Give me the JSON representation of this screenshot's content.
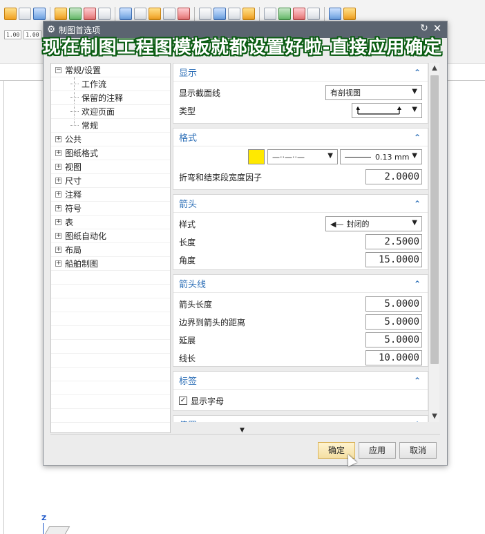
{
  "toolbar": {
    "num_a": "1.00",
    "num_b": "1.00"
  },
  "axis": {
    "z_label": "Z"
  },
  "dialog": {
    "title": "制图首选项",
    "reset_glyph": "↻",
    "close_glyph": "✕"
  },
  "tree": {
    "items": [
      {
        "label": "常规/设置",
        "expander": "−",
        "level": 0
      },
      {
        "label": "工作流",
        "expander": "",
        "level": 1
      },
      {
        "label": "保留的注释",
        "expander": "",
        "level": 1
      },
      {
        "label": "欢迎页面",
        "expander": "",
        "level": 1
      },
      {
        "label": "常规",
        "expander": "",
        "level": 1
      },
      {
        "label": "公共",
        "expander": "+",
        "level": 0
      },
      {
        "label": "图纸格式",
        "expander": "+",
        "level": 0
      },
      {
        "label": "视图",
        "expander": "+",
        "level": 0
      },
      {
        "label": "尺寸",
        "expander": "+",
        "level": 0
      },
      {
        "label": "注释",
        "expander": "+",
        "level": 0
      },
      {
        "label": "符号",
        "expander": "+",
        "level": 0
      },
      {
        "label": "表",
        "expander": "+",
        "level": 0
      },
      {
        "label": "图纸自动化",
        "expander": "+",
        "level": 0
      },
      {
        "label": "布局",
        "expander": "+",
        "level": 0
      },
      {
        "label": "船舶制图",
        "expander": "+",
        "level": 0
      }
    ]
  },
  "display": {
    "title": "显示",
    "section_line_label": "显示截面线",
    "section_line_value": "有剖视图",
    "type_label": "类型"
  },
  "format": {
    "title": "格式",
    "color": "#ffe900",
    "line_style": "—··—··—",
    "line_width": "0.13 mm",
    "fold_factor_label": "折弯和结束段宽度因子",
    "fold_factor_value": "2.0000"
  },
  "arrow": {
    "title": "箭头",
    "style_label": "样式",
    "style_value": "封闭的",
    "length_label": "长度",
    "length_value": "2.5000",
    "angle_label": "角度",
    "angle_value": "15.0000"
  },
  "arrow_line": {
    "title": "箭头线",
    "arrow_len_label": "箭头长度",
    "arrow_len_value": "5.0000",
    "border_dist_label": "边界到箭头的距离",
    "border_dist_value": "5.0000",
    "extension_label": "延展",
    "extension_value": "5.0000",
    "line_len_label": "线长",
    "line_len_value": "10.0000"
  },
  "labels": {
    "title": "标签",
    "show_letter_label": "显示字母",
    "show_letter_checked": "✓"
  },
  "offset": {
    "title": "偏置"
  },
  "buttons": {
    "ok": "确定",
    "apply": "应用",
    "cancel": "取消"
  },
  "caption": "现在制图工程图模板就都设置好啦-直接应用确定"
}
